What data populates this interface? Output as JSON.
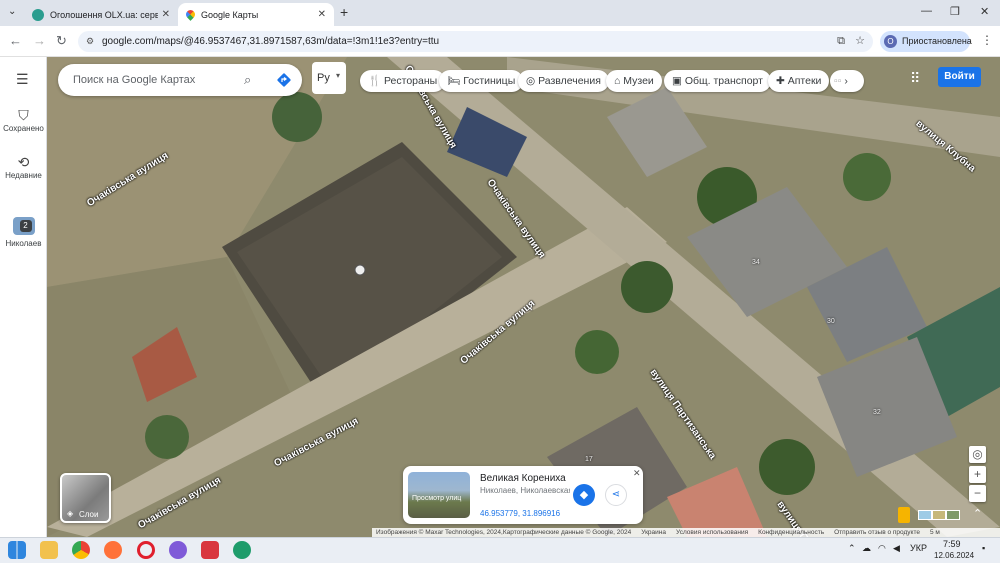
{
  "browser": {
    "tabs": [
      {
        "title": "Оголошення OLX.ua: сервіс оголошень",
        "active": false
      },
      {
        "title": "Google Карты",
        "active": true
      }
    ],
    "url": "google.com/maps/@46.9537467,31.8971587,63m/data=!3m1!1e3?entry=ttu",
    "profile_label": "Приостановлена",
    "new_tab_label": "+"
  },
  "rail": {
    "saved": "Сохранено",
    "recent": "Недавние",
    "recent_place": "Николаев",
    "recent_count": "2"
  },
  "search": {
    "placeholder": "Поиск на Google Картах"
  },
  "map_controls": {
    "lang_label": "Ру",
    "categories": [
      "Рестораны",
      "Гостиницы",
      "Развлечения",
      "Музеи",
      "Общ. транспорт",
      "Аптеки"
    ],
    "signin_label": "Войти",
    "layers_label": "Слои"
  },
  "streets": {
    "ochakivska": "Очаківська вулиця",
    "ochakivska_short": "Очаківська вулиця",
    "klubna": "вулиця Клубна",
    "partyzanska": "вулиця Партизанська",
    "top_partial": "Очаківська вулиця",
    "bottom_partial": "вулиця П"
  },
  "house_numbers": [
    "34",
    "30",
    "32",
    "17"
  ],
  "place_card": {
    "title": "Великая Корениха",
    "subtitle": "Николаев, Николаевская область",
    "coords": "46.953779, 31.896916",
    "thumb_label": "Просмотр улиц"
  },
  "attribution": {
    "imagery": "Изображения © Maxar Technologies, 2024,Картографические данные © Google, 2024",
    "country": "Украина",
    "terms": "Условия использования",
    "privacy": "Конфиденциальность",
    "feedback": "Отправить отзыв о продукте",
    "scale": "5 м"
  },
  "taskbar": {
    "language": "УКР",
    "time": "7:59",
    "date": "12.06.2024"
  },
  "colors": {
    "accent": "#1a73e8",
    "active_tab": "#ffffff",
    "profile_chip": "#d3e3fd"
  }
}
